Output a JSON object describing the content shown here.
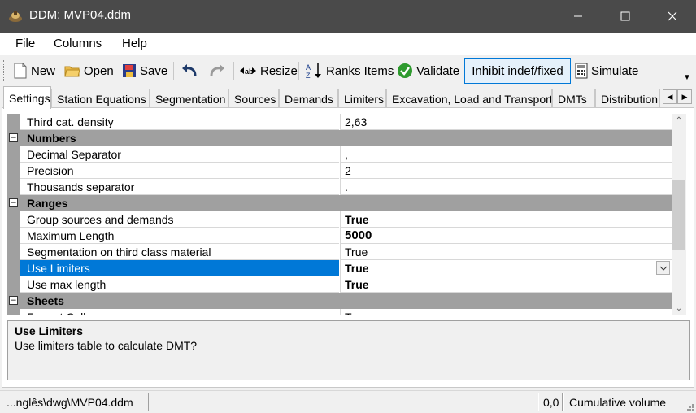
{
  "window": {
    "title": "DDM: MVP04.ddm"
  },
  "menu": [
    "File",
    "Columns",
    "Help"
  ],
  "toolbar": {
    "new": "New",
    "open": "Open",
    "save": "Save",
    "resize": "Resize",
    "ranks_items": "Ranks Items",
    "validate": "Validate",
    "inhibit": "Inhibit indef/fixed",
    "simulate": "Simulate"
  },
  "tabs": [
    "Settings",
    "Station Equations",
    "Segmentation",
    "Sources",
    "Demands",
    "Limiters",
    "Excavation, Load and Transport",
    "DMTs",
    "Distribution"
  ],
  "grid": {
    "rows": [
      {
        "name": "Third cat. density",
        "value": "2,63"
      },
      {
        "category": "Numbers"
      },
      {
        "name": "Decimal Separator",
        "value": ","
      },
      {
        "name": "Precision",
        "value": "2"
      },
      {
        "name": "Thousands separator",
        "value": "."
      },
      {
        "category": "Ranges"
      },
      {
        "name": "Group sources and demands",
        "value": "True"
      },
      {
        "name": "Maximum Length",
        "value": "5000"
      },
      {
        "name": "Segmentation on third class material",
        "value": "True"
      },
      {
        "name": "Use Limiters",
        "value": "True"
      },
      {
        "name": "Use max length",
        "value": "True"
      },
      {
        "category": "Sheets"
      },
      {
        "name": "Format Cells",
        "value": "True"
      }
    ]
  },
  "description": {
    "title": "Use Limiters",
    "text": "Use limiters table to calculate DMT?"
  },
  "status": {
    "path": "...nglês\\dwg\\MVP04.ddm",
    "coords": "0,0",
    "mode": "Cumulative volume"
  },
  "colors": {
    "selection": "#0078d7",
    "titlebar": "#4a4a4a",
    "category": "#a0a0a0"
  }
}
